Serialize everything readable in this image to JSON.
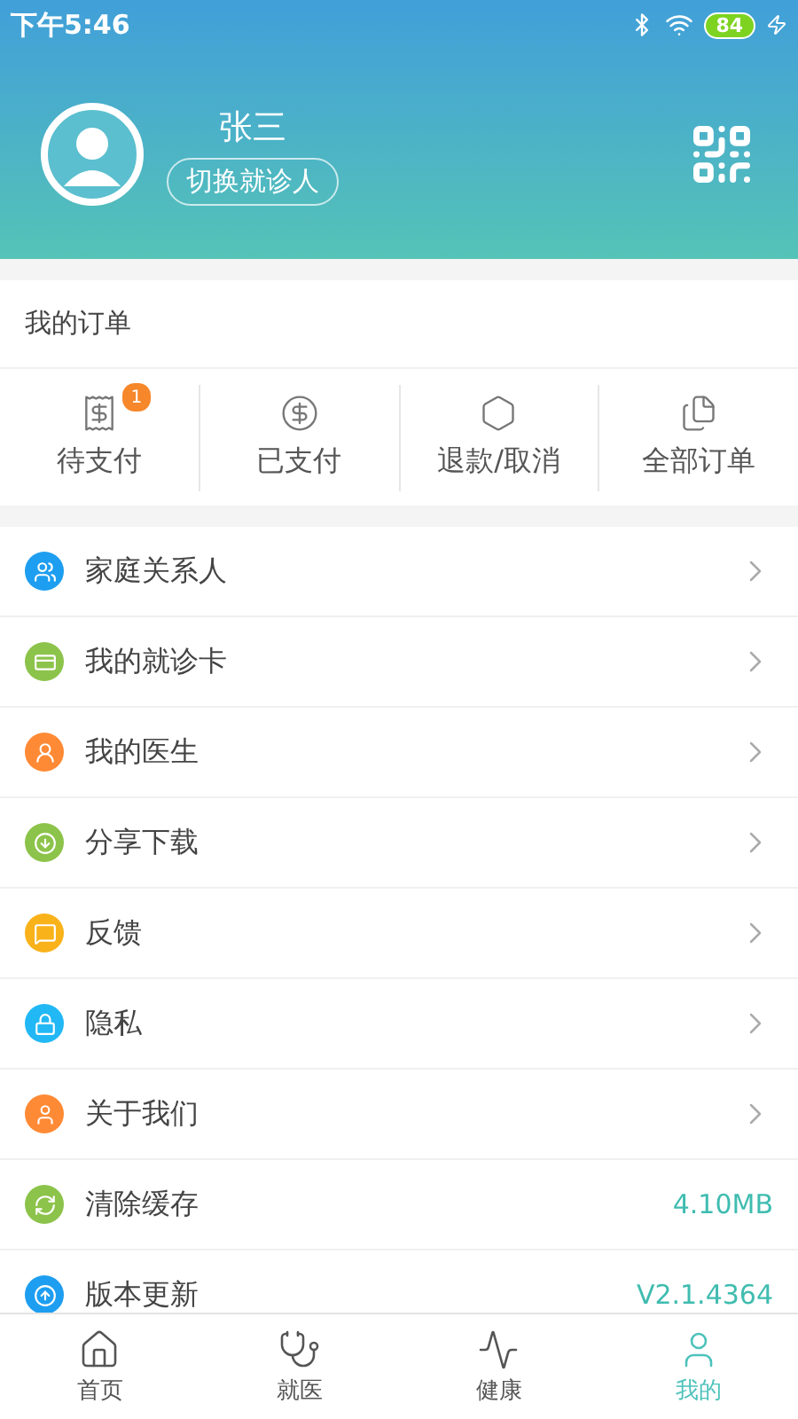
{
  "status_bar": {
    "time": "下午5:46",
    "battery": "84"
  },
  "profile": {
    "name": "张三",
    "switch_button": "切换就诊人"
  },
  "orders": {
    "title": "我的订单",
    "items": [
      {
        "label": "待支付",
        "badge": "1"
      },
      {
        "label": "已支付"
      },
      {
        "label": "退款/取消"
      },
      {
        "label": "全部订单"
      }
    ]
  },
  "menu": [
    {
      "label": "家庭关系人",
      "color": "#1e9ef0",
      "kind": "arrow"
    },
    {
      "label": "我的就诊卡",
      "color": "#8cc34a",
      "kind": "arrow"
    },
    {
      "label": "我的医生",
      "color": "#ff8a35",
      "kind": "arrow"
    },
    {
      "label": "分享下载",
      "color": "#8cc34a",
      "kind": "arrow"
    },
    {
      "label": "反馈",
      "color": "#f9b21a",
      "kind": "arrow"
    },
    {
      "label": "隐私",
      "color": "#22b8f5",
      "kind": "arrow"
    },
    {
      "label": "关于我们",
      "color": "#ff8a35",
      "kind": "arrow"
    },
    {
      "label": "清除缓存",
      "color": "#8cc34a",
      "kind": "value",
      "value": "4.10MB"
    },
    {
      "label": "版本更新",
      "color": "#1e9ef0",
      "kind": "value",
      "value": "V2.1.4364"
    }
  ],
  "tabs": [
    {
      "label": "首页",
      "selected": false
    },
    {
      "label": "就医",
      "selected": false
    },
    {
      "label": "健康",
      "selected": false
    },
    {
      "label": "我的",
      "selected": true
    }
  ]
}
